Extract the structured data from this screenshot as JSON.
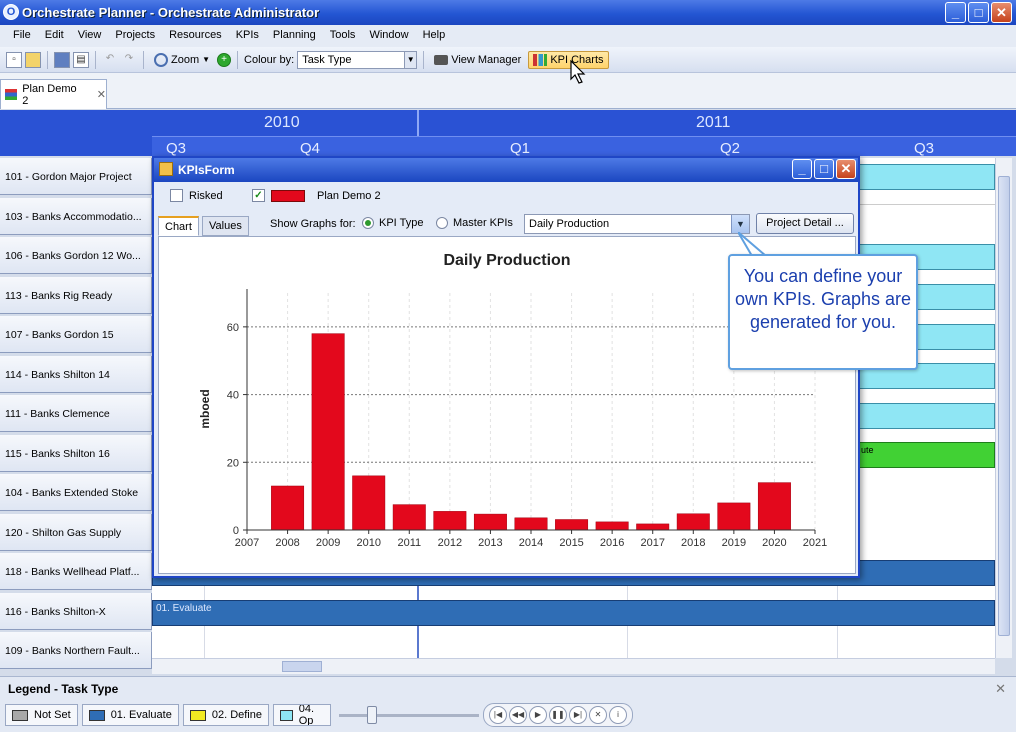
{
  "window": {
    "title": "Orchestrate Planner - Orchestrate Administrator"
  },
  "menu": [
    "File",
    "Edit",
    "View",
    "Projects",
    "Resources",
    "KPIs",
    "Planning",
    "Tools",
    "Window",
    "Help"
  ],
  "toolbar": {
    "zoom_label": "Zoom",
    "colour_by_label": "Colour by:",
    "colour_by_value": "Task Type",
    "view_manager_label": "View Manager",
    "kpi_charts_label": "KPI Charts"
  },
  "doc_tab": {
    "label": "Plan Demo 2"
  },
  "timeline": {
    "years": [
      "2010",
      "2011"
    ],
    "quarters": [
      "Q3",
      "Q4",
      "Q1",
      "Q2",
      "Q3"
    ]
  },
  "rows": [
    "101 - Gordon Major Project",
    "103 - Banks Accommodatio...",
    "106 - Banks Gordon 12 Wo...",
    "113 - Banks Rig Ready",
    "107 - Banks Gordon 15",
    "114 - Banks Shilton 14",
    "111 - Banks Clemence",
    "115 - Banks Shilton 16",
    "104 - Banks Extended Stoke",
    "120 - Shilton Gas Supply",
    "118 - Banks Wellhead Platf...",
    "116 - Banks Shilton-X",
    "109 - Banks Northern Fault..."
  ],
  "gantt_labels": {
    "evaluate_bar": "01. Evaluate",
    "green_bar": "ute"
  },
  "kpi_form": {
    "title": "KPIsForm",
    "risked_label": "Risked",
    "plan_label": "Plan Demo 2",
    "tabs": [
      "Chart",
      "Values"
    ],
    "show_graphs_label": "Show Graphs for:",
    "radio_kpi_type": "KPI Type",
    "radio_master_kpis": "Master KPIs",
    "kpi_select_value": "Daily Production",
    "project_detail_button": "Project Detail ..."
  },
  "callout": {
    "text": "You can define your own KPIs. Graphs are generated for you."
  },
  "legend": {
    "title": "Legend - Task Type",
    "items": [
      {
        "label": "Not Set",
        "color": "#a8a8a8"
      },
      {
        "label": "01. Evaluate",
        "color": "#2f6db5"
      },
      {
        "label": "02. Define",
        "color": "#f2ea22"
      },
      {
        "label": "04. Op",
        "color": "#8fe6f4"
      }
    ]
  },
  "colors": {
    "accent": "#2456d3",
    "bar_red": "#e3081c",
    "gantt_cyan": "#8fe6f4",
    "gantt_blue": "#2f6db5",
    "gantt_green": "#41d134"
  },
  "chart_data": {
    "type": "bar",
    "title": "Daily Production",
    "ylabel": "mboed",
    "xlabel": "",
    "x": [
      2008,
      2009,
      2010,
      2011,
      2012,
      2013,
      2014,
      2015,
      2016,
      2017,
      2018,
      2019,
      2020
    ],
    "values": [
      13,
      58,
      16,
      7.5,
      5.5,
      4.7,
      3.6,
      3.1,
      2.4,
      1.8,
      4.8,
      8,
      14
    ],
    "xlim": [
      2007,
      2021
    ],
    "ylim": [
      0,
      70
    ],
    "x_ticks": [
      "2007",
      "2008",
      "2009",
      "2010",
      "2011",
      "2012",
      "2013",
      "2014",
      "2015",
      "2016",
      "2017",
      "2018",
      "2019",
      "2020",
      "2021"
    ],
    "y_ticks": [
      "0",
      "20",
      "40",
      "60"
    ],
    "grid": true
  }
}
